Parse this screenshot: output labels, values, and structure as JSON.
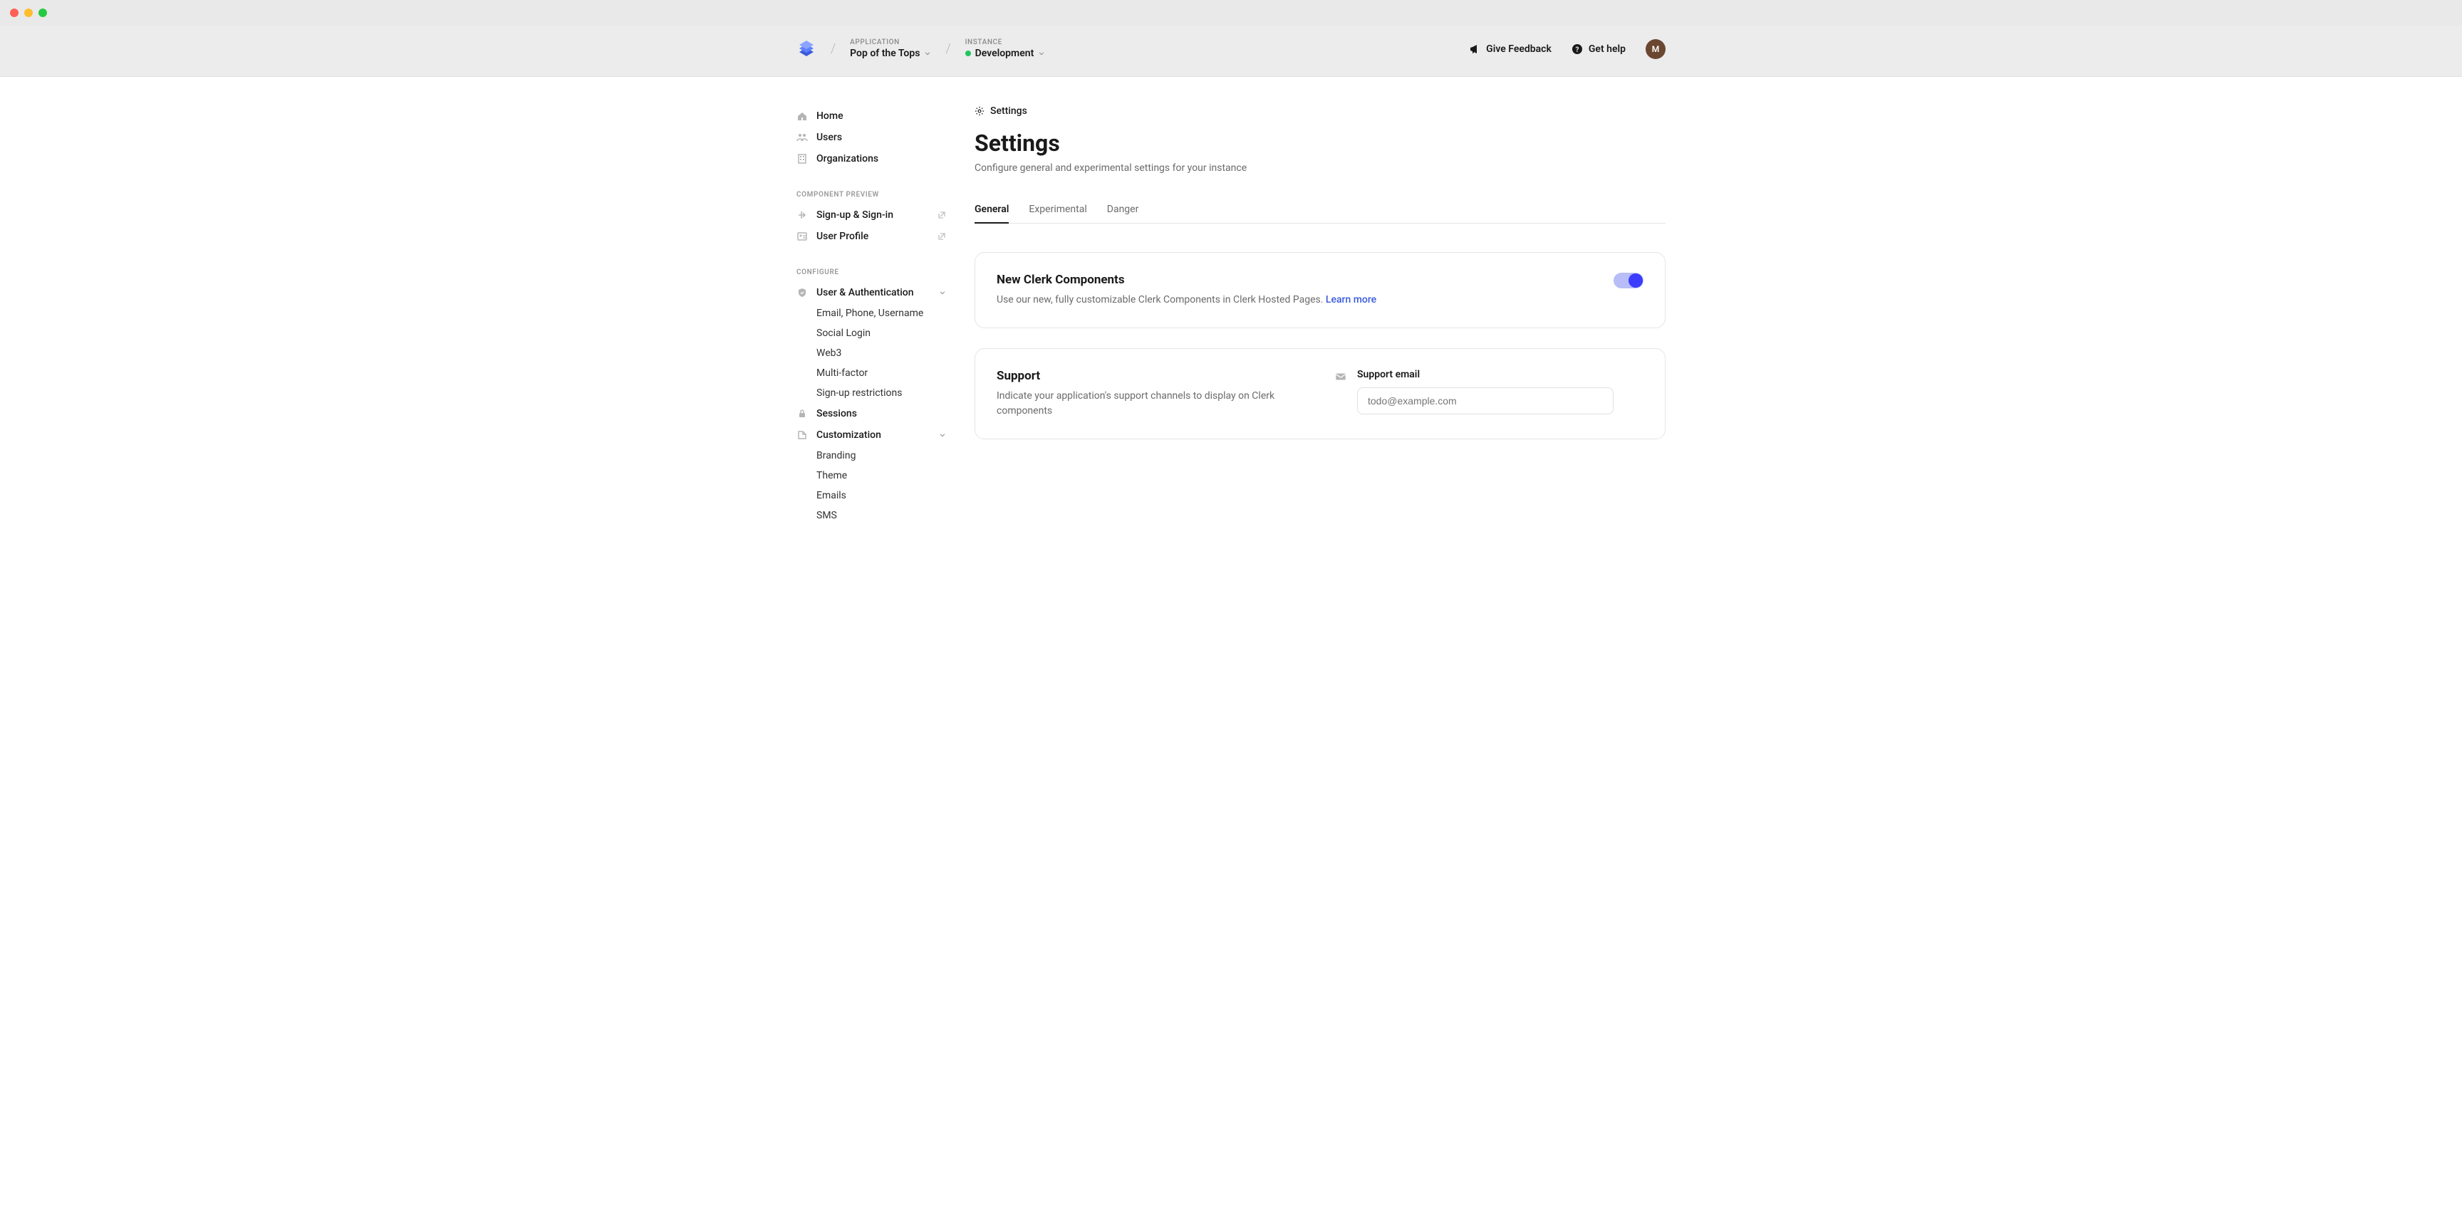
{
  "header": {
    "application_label": "APPLICATION",
    "application_value": "Pop of the Tops",
    "instance_label": "INSTANCE",
    "instance_value": "Development",
    "feedback": "Give Feedback",
    "help": "Get help",
    "avatar_initial": "M"
  },
  "sidebar": {
    "top": [
      {
        "label": "Home"
      },
      {
        "label": "Users"
      },
      {
        "label": "Organizations"
      }
    ],
    "preview_title": "COMPONENT PREVIEW",
    "preview": [
      {
        "label": "Sign-up & Sign-in"
      },
      {
        "label": "User Profile"
      }
    ],
    "configure_title": "CONFIGURE",
    "user_auth_label": "User & Authentication",
    "user_auth_items": [
      {
        "label": "Email, Phone, Username"
      },
      {
        "label": "Social Login"
      },
      {
        "label": "Web3"
      },
      {
        "label": "Multi-factor"
      },
      {
        "label": "Sign-up restrictions"
      }
    ],
    "sessions_label": "Sessions",
    "customization_label": "Customization",
    "customization_items": [
      {
        "label": "Branding"
      },
      {
        "label": "Theme"
      },
      {
        "label": "Emails"
      },
      {
        "label": "SMS"
      }
    ]
  },
  "page": {
    "breadcrumb": "Settings",
    "title": "Settings",
    "subtitle": "Configure general and experimental settings for your instance",
    "tabs": [
      {
        "label": "General",
        "active": true
      },
      {
        "label": "Experimental",
        "active": false
      },
      {
        "label": "Danger",
        "active": false
      }
    ],
    "card_clerk": {
      "title": "New Clerk Components",
      "desc": "Use our new, fully customizable Clerk Components in Clerk Hosted Pages. ",
      "link": "Learn more",
      "toggle_on": true
    },
    "card_support": {
      "title": "Support",
      "desc": "Indicate your application's support channels to display on Clerk components",
      "field_label": "Support email",
      "field_placeholder": "todo@example.com"
    }
  }
}
